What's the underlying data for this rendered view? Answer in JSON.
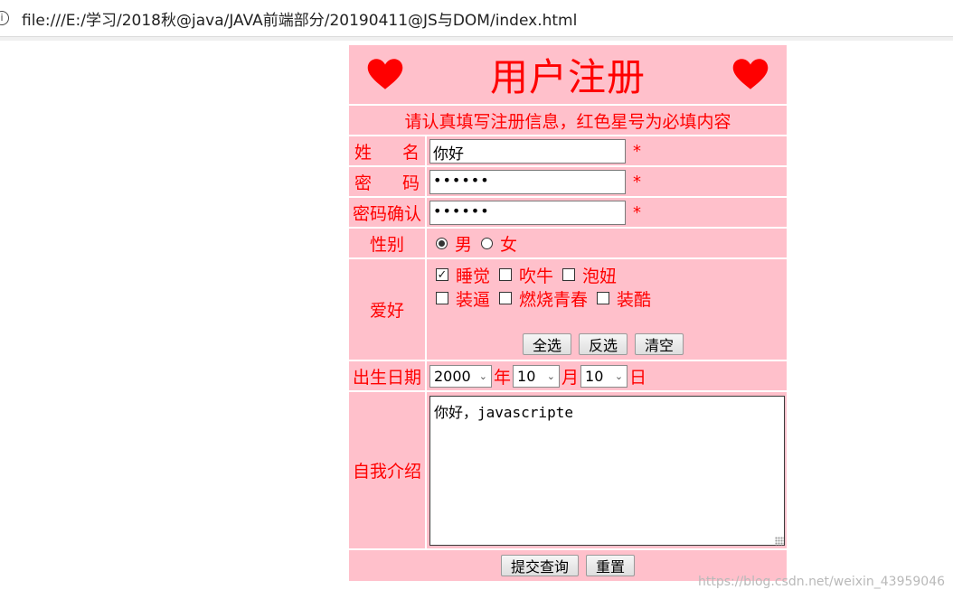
{
  "browser": {
    "url": "file:///E:/学习/2018秋@java/JAVA前端部分/20190411@JS与DOM/index.html"
  },
  "form": {
    "title": "用户注册",
    "subtitle": "请认真填写注册信息，红色星号为必填内容",
    "required_mark": "*",
    "name": {
      "label": "姓 名",
      "value": "你好"
    },
    "password": {
      "label": "密 码",
      "value": "••••••"
    },
    "password_confirm": {
      "label": "密码确认",
      "value": "••••••"
    },
    "gender": {
      "label": "性别",
      "options": [
        "男",
        "女"
      ],
      "selected": "男"
    },
    "hobbies": {
      "label": "爱好",
      "options": [
        {
          "label": "睡觉",
          "checked": true
        },
        {
          "label": "吹牛",
          "checked": false
        },
        {
          "label": "泡妞",
          "checked": false
        },
        {
          "label": "装逼",
          "checked": false
        },
        {
          "label": "燃烧青春",
          "checked": false
        },
        {
          "label": "装酷",
          "checked": false
        }
      ],
      "buttons": {
        "select_all": "全选",
        "invert": "反选",
        "clear": "清空"
      }
    },
    "birthday": {
      "label": "出生日期",
      "year": "2000",
      "year_unit": "年",
      "month": "10",
      "month_unit": "月",
      "day": "10",
      "day_unit": "日"
    },
    "intro": {
      "label": "自我介绍",
      "value": "你好，javascripte"
    },
    "submit_label": "提交查询",
    "reset_label": "重置"
  },
  "watermark": "https://blog.csdn.net/weixin_43959046",
  "colors": {
    "row_bg": "#ffc0cb",
    "text": "#ff0000",
    "heart": "#ff0000"
  },
  "icons": {
    "heart": "heart-icon",
    "info": "info-icon"
  }
}
